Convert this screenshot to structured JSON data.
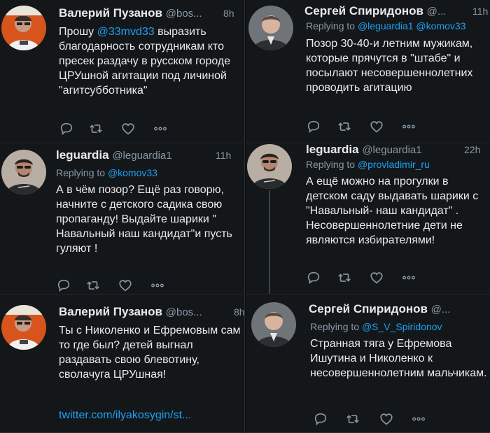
{
  "tweets": [
    {
      "name": "Валерий Пузанов",
      "handle": "@bos...",
      "time": "8h",
      "mention": "@33mvd33",
      "text_before": "Прошу",
      "text_after": "выразить благодарность сотрудникам кто пресек раздачу в русском городе ЦРУшной агитации под личиной \"агитсубботника\""
    },
    {
      "name": "Сергей Спиридонов",
      "handle": "@...",
      "time": "11h",
      "reply_label": "Replying to",
      "reply_to": "@leguardia1 @komov33",
      "text": "Позор 30-40-и летним мужикам, которые прячутся в \"штабе\" и посылают несовершеннолетних проводить агитацию"
    },
    {
      "name": "leguardia",
      "handle": "@leguardia1",
      "time": "11h",
      "reply_label": "Replying to",
      "reply_to": "@komov33",
      "text": "А в чём позор? Ещё раз говорю, начните с детского садика свою пропаганду! Выдайте шарики \" Навальный наш кандидат\"и пусть гуляют !"
    },
    {
      "name": "leguardia",
      "handle": "@leguardia1",
      "time": "22h",
      "reply_label": "Replying to",
      "reply_to": "@provladimir_ru",
      "text": "А ещё можно на прогулки в детском саду выдавать шарики с \"Навальный- наш кандидат\" . Несовершеннолетние дети не являются избирателями!"
    },
    {
      "name": "Валерий Пузанов",
      "handle": "@bos...",
      "time": "8h",
      "text": "Ты с Николенко и Ефремовым сам то где был? детей выгнал раздавать свою блевотину, сволачуга ЦРУшная!",
      "link": "twitter.com/ilyakosygin/st..."
    },
    {
      "name": "Сергей Спиридонов",
      "handle": "@...",
      "reply_label": "Replying to",
      "reply_to": "@S_V_Spiridonov",
      "text": "Странная тяга у Ефремова Ишутина и Николенко к несовершеннолетним мальчикам."
    }
  ],
  "icons": [
    "reply-icon",
    "retweet-icon",
    "like-icon",
    "more-icon"
  ],
  "colors": {
    "background": "#14171a",
    "text": "#e9ebee",
    "muted": "#8899a6",
    "link": "#1da1f2"
  }
}
